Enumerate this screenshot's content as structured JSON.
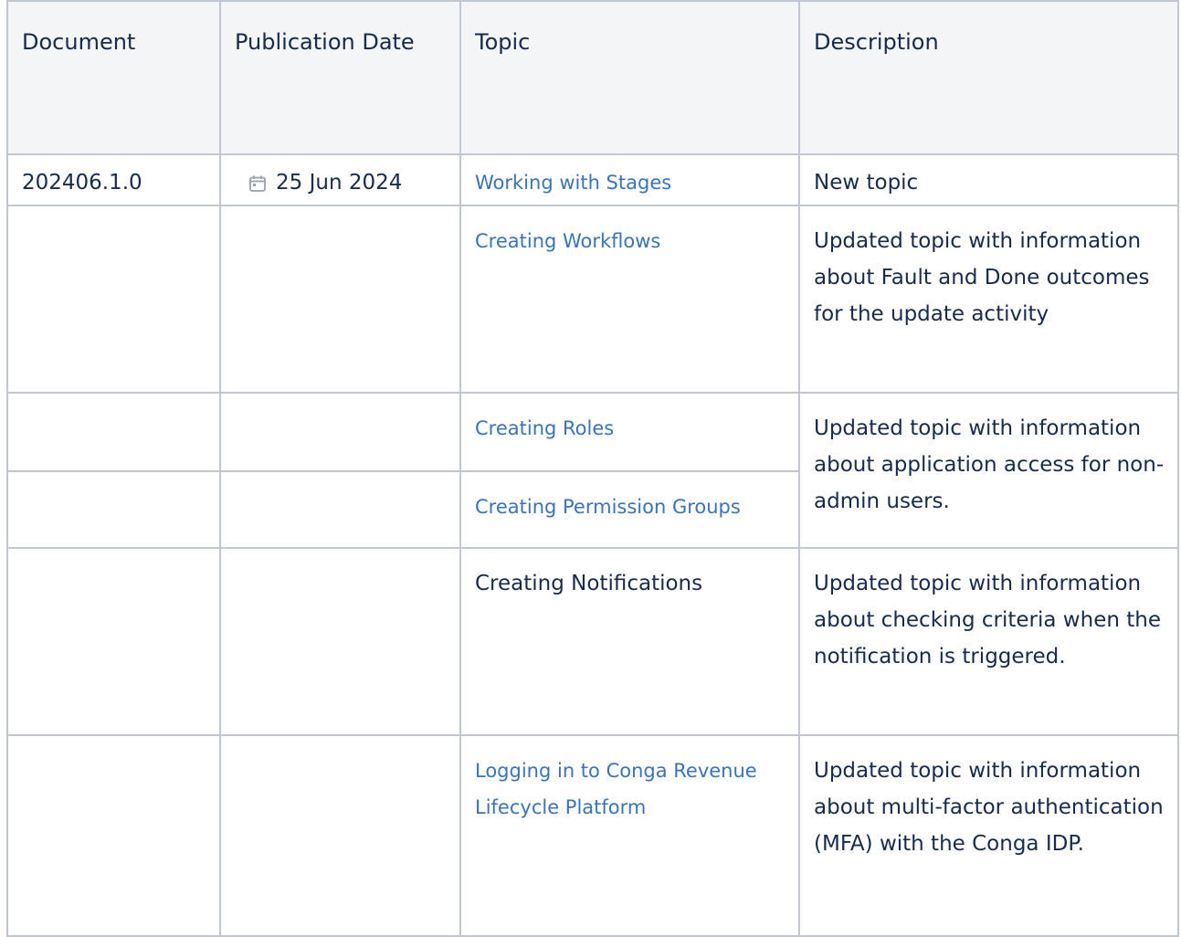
{
  "table": {
    "headers": {
      "document": "Document",
      "publication_date": "Publication Date",
      "topic": "Topic",
      "description": "Description"
    },
    "rows": [
      {
        "document": "202406.1.0",
        "date": "25 Jun 2024",
        "topic": "Working with Stages",
        "description": "New topic"
      },
      {
        "topic": "Creating Workflows",
        "description": "Updated topic with information about Fault and Done outcomes for the update activity"
      },
      {
        "topic": "Creating Roles",
        "description": "Updated topic with information about application access for non-admin users."
      },
      {
        "topic": "Creating Permission Groups"
      },
      {
        "topic": "Creating Notifications",
        "description": "Updated topic with information about checking criteria when the notification is triggered."
      },
      {
        "topic": "Logging in to Conga Revenue Lifecycle Platform",
        "description": "Updated topic with information about multi-factor authentication (MFA) with the Conga IDP."
      }
    ]
  },
  "icons": {
    "date_icon": "calendar-icon"
  },
  "colors": {
    "link": "#3b73b9",
    "text": "#172b4d",
    "header_bg": "#f4f5f7",
    "border": "#c1c7d0"
  }
}
